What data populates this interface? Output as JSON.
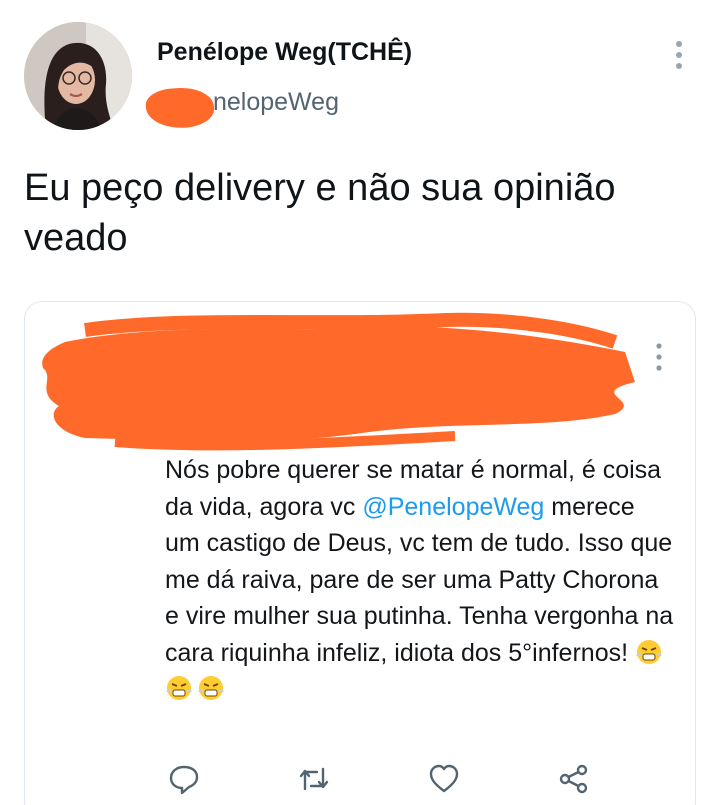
{
  "author": {
    "name": "Penélope Weg(TCHÊ)",
    "handle": "PenelopeWeg"
  },
  "tweet": {
    "text": "Eu peço delivery e não sua opinião veado"
  },
  "quoted_tweet": {
    "text_before_mention": "Nós pobre querer se matar é normal, é coisa da vida, agora vc ",
    "mention": "@PenelopeWeg",
    "text_after_mention": " merece um castigo de Deus, vc tem de tudo. Isso que me dá raiva, pare de ser uma Patty Chorona e vire mulher sua putinha. Tenha vergonha na cara riquinha infeliz, idiota dos 5°infernos! ",
    "emoji_count": 3
  },
  "icons": {
    "more": "more-vertical-icon",
    "reply": "reply-icon",
    "retweet": "retweet-icon",
    "like": "like-icon",
    "share": "share-icon",
    "emoji": "angry-emoji-icon"
  },
  "colors": {
    "link": "#1d9bf0",
    "redaction": "#ff6a2b",
    "icon_gray": "#536471"
  }
}
